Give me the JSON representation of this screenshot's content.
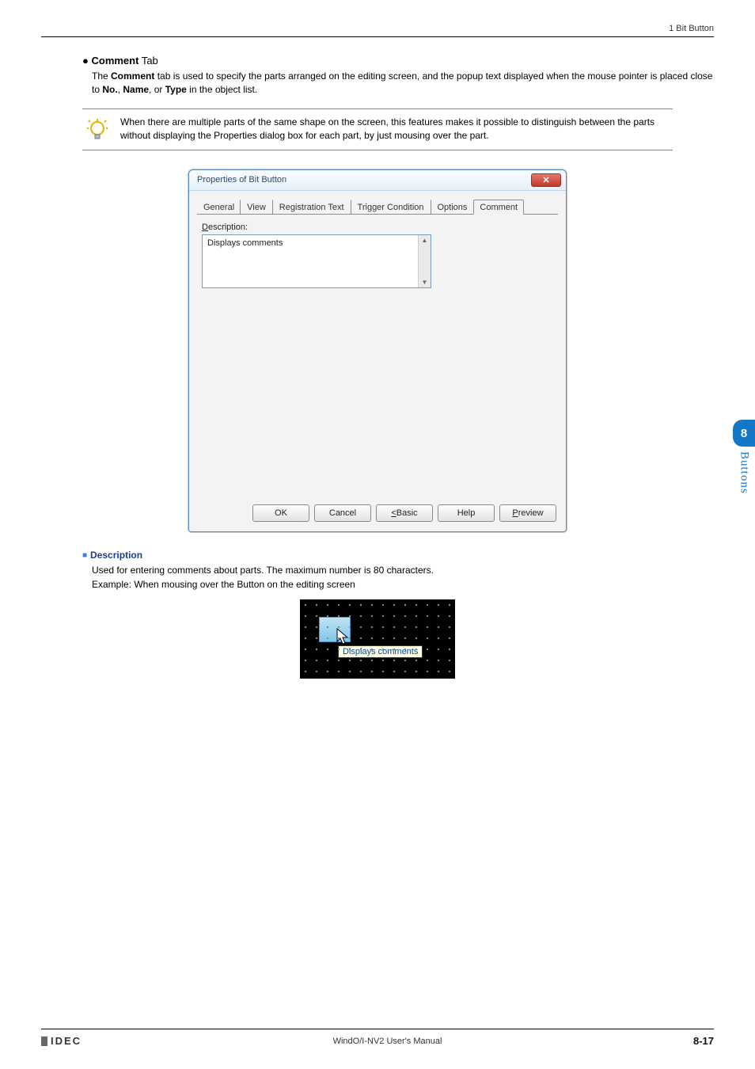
{
  "header": {
    "section": "1 Bit Button"
  },
  "sectionTitle": {
    "bullet": "●",
    "boldLabel": "Comment",
    "suffix": " Tab"
  },
  "intro": {
    "p1a": "The ",
    "p1b": "Comment",
    "p1c": " tab is used to specify the parts arranged on the editing screen, and the popup text displayed when the mouse pointer is placed close to ",
    "no": "No.",
    "sep1": ", ",
    "name": "Name",
    "sep2": ", or ",
    "type": "Type",
    "tail": " in the object list."
  },
  "tip": "When there are multiple parts of the same shape on the screen, this features makes it possible to distinguish between the parts without displaying the Properties dialog box for each part, by just mousing over the part.",
  "dialog": {
    "title": "Properties of Bit Button",
    "closeGlyph": "✕",
    "tabs": {
      "general": "General",
      "view": "View",
      "regText": "Registration Text",
      "trigger": "Trigger Condition",
      "options": "Options",
      "comment": "Comment"
    },
    "descLabelPrefix": "D",
    "descLabelRest": "escription:",
    "descValue": "Displays comments",
    "scrollUp": "▲",
    "scrollDown": "▼",
    "buttons": {
      "ok": "OK",
      "cancel": "Cancel",
      "basicPrefix": "<",
      "basicRest": " Basic",
      "help": "Help",
      "previewPrefix": "P",
      "previewRest": "review"
    }
  },
  "description": {
    "heading": "Description",
    "line1": "Used for entering comments about parts. The maximum number is 80 characters.",
    "line2": "Example: When mousing over the Button on the editing screen",
    "tooltip": "Displays comments"
  },
  "sideTab": {
    "num": "8",
    "label": "Buttons"
  },
  "footer": {
    "brand": "IDEC",
    "center": "WindO/I-NV2 User's Manual",
    "page": "8-17"
  }
}
